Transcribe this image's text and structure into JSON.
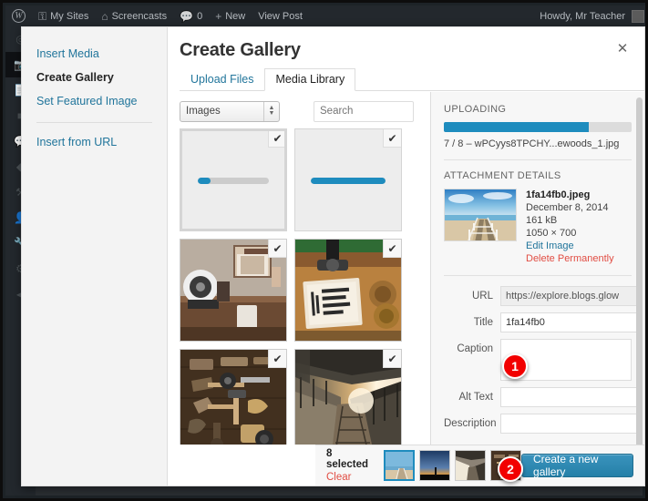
{
  "adminbar": {
    "logo_icon": "wordpress-logo-icon",
    "items": [
      {
        "icon": "key-icon",
        "glyph": "⚿",
        "label": "My Sites"
      },
      {
        "icon": "home-icon",
        "glyph": "⌂",
        "label": "Screencasts"
      },
      {
        "icon": "comment-icon",
        "glyph": "▬",
        "label": "0"
      },
      {
        "icon": "plus-icon",
        "glyph": "+",
        "label": "New"
      },
      {
        "icon": "",
        "glyph": "",
        "label": "View Post"
      }
    ],
    "howdy": "Howdy, Mr Teacher"
  },
  "modal": {
    "title": "Create Gallery",
    "close_icon": "close-icon",
    "sidebar": {
      "items": [
        {
          "label": "Insert Media",
          "active": false
        },
        {
          "label": "Create Gallery",
          "active": true
        },
        {
          "label": "Set Featured Image",
          "active": false
        }
      ],
      "secondary": [
        {
          "label": "Insert from URL"
        }
      ]
    },
    "tabs": [
      {
        "label": "Upload Files",
        "active": false
      },
      {
        "label": "Media Library",
        "active": true
      }
    ],
    "toolbar": {
      "filter_value": "Images",
      "search_placeholder": "Search"
    },
    "grid": [
      {
        "state": "uploading",
        "selected": true,
        "checked": true,
        "progress": 18,
        "alt": "uploading-placeholder"
      },
      {
        "state": "uploading",
        "selected": false,
        "checked": true,
        "progress": 100,
        "alt": "uploading-placeholder"
      },
      {
        "state": "image",
        "selected": false,
        "checked": true,
        "alt": "desk-with-speaker-and-monitor"
      },
      {
        "state": "image",
        "selected": false,
        "checked": true,
        "alt": "notebook-dont-waste-your-theme"
      },
      {
        "state": "image",
        "selected": false,
        "checked": true,
        "alt": "vintage-tools-on-wood"
      },
      {
        "state": "image",
        "selected": false,
        "checked": true,
        "alt": "train-station-at-sunset"
      }
    ],
    "attachment_panel": {
      "uploading_title": "UPLOADING",
      "progress_percent": 77,
      "progress_status": "7 / 8 – wPCyys8TPCHY...ewoods_1.jpg",
      "details_title": "ATTACHMENT DETAILS",
      "filename": "1fa14fb0.jpeg",
      "date": "December 8, 2014",
      "filesize": "161 kB",
      "dimensions": "1050 × 700",
      "edit_link": "Edit Image",
      "delete_link": "Delete Permanently",
      "thumb_alt": "pier-over-ocean",
      "fields": [
        {
          "label": "URL",
          "type": "text",
          "value": "https://explore.blogs.glow",
          "readonly": true
        },
        {
          "label": "Title",
          "type": "text",
          "value": "1fa14fb0",
          "readonly": false
        },
        {
          "label": "Caption",
          "type": "textarea",
          "value": "",
          "readonly": false
        },
        {
          "label": "Alt Text",
          "type": "text",
          "value": "",
          "readonly": false
        },
        {
          "label": "Description",
          "type": "text",
          "value": "",
          "readonly": false
        }
      ]
    },
    "footer": {
      "selected_count": "8 selected",
      "clear_label": "Clear",
      "thumbs": [
        {
          "alt": "pier-over-ocean",
          "active": true
        },
        {
          "alt": "sunset-horizon",
          "active": false
        },
        {
          "alt": "train-station",
          "active": false
        },
        {
          "alt": "vintage-tools",
          "active": false
        }
      ],
      "create_button": "Create a new gallery"
    }
  },
  "annotations": [
    {
      "number": "1",
      "target": "caption-field"
    },
    {
      "number": "2",
      "target": "create-gallery-button"
    }
  ],
  "colors": {
    "accent_blue": "#1e8cbe",
    "link_blue": "#21759b",
    "danger_red": "#e14d43",
    "badge_red": "#f20000",
    "adminbar_bg": "#23282d"
  }
}
